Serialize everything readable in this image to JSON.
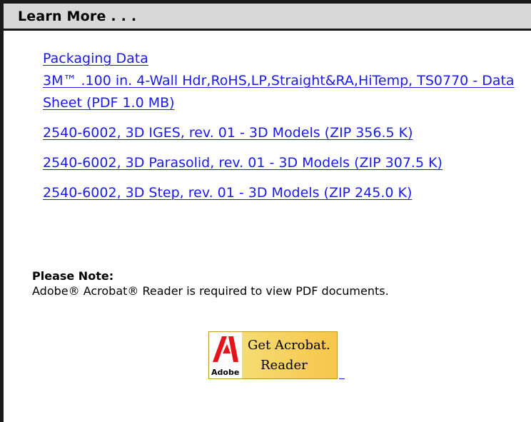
{
  "section": {
    "title": "Learn More . . ."
  },
  "links": [
    {
      "text": "Packaging Data"
    },
    {
      "text": "3M™ .100 in. 4-Wall Hdr,RoHS,LP,Straight&RA,HiTemp, TS0770 - Data Sheet (PDF 1.0 MB)"
    },
    {
      "text": "2540-6002, 3D IGES, rev. 01 - 3D Models (ZIP 356.5 K)"
    },
    {
      "text": "2540-6002, 3D Parasolid, rev. 01 - 3D Models (ZIP 307.5 K)"
    },
    {
      "text": "2540-6002, 3D Step, rev. 01 - 3D Models (ZIP 245.0 K)"
    }
  ],
  "note": {
    "title": "Please Note:",
    "text": "Adobe® Acrobat® Reader is required to view PDF documents."
  },
  "acrobat_badge": {
    "line1": "Get Acrobat.",
    "line2": "Reader",
    "brand": "Adobe",
    "icon": "adobe-logo-icon"
  },
  "colors": {
    "link": "#1a1aee",
    "header_bg": "#d8d8d8",
    "border": "#1a1a1a",
    "badge_yellow": "#f7c64a",
    "adobe_red": "#e3141b"
  }
}
